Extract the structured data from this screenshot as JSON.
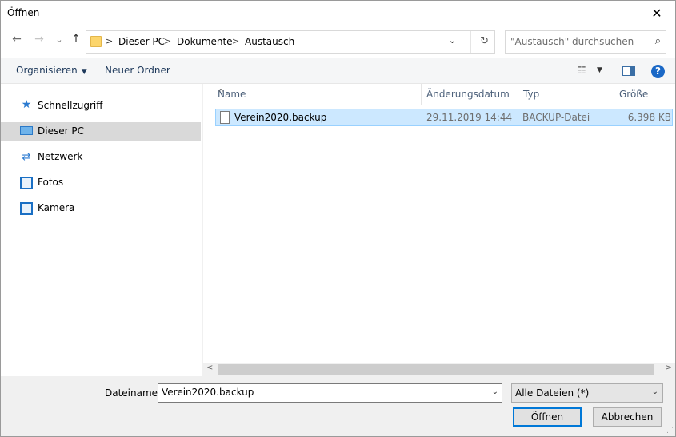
{
  "window": {
    "title": "Öffnen",
    "close": "✕"
  },
  "nav": {
    "back": "←",
    "forward": "→",
    "recent": "⌄",
    "up": "↑"
  },
  "breadcrumb": {
    "sep": ">",
    "items": [
      "Dieser PC",
      "Dokumente",
      "Austausch"
    ],
    "dropdown": "⌄",
    "refresh": "↻"
  },
  "search": {
    "placeholder": "\"Austausch\" durchsuchen",
    "icon": "⌕"
  },
  "toolbar": {
    "organize_label": "Organisieren",
    "organize_caret": "▼",
    "new_folder_label": "Neuer Ordner",
    "view_icon": "☷",
    "view_caret": "▼",
    "help_label": "?"
  },
  "sidebar": {
    "items": [
      {
        "label": "Schnellzugriff",
        "icon": "★"
      },
      {
        "label": "Dieser PC",
        "icon": ""
      },
      {
        "label": "Netzwerk",
        "icon": "⇄"
      },
      {
        "label": "Fotos",
        "icon": ""
      },
      {
        "label": "Kamera",
        "icon": ""
      }
    ],
    "selected": "Dieser PC"
  },
  "columns": {
    "name": "Name",
    "date": "Änderungsdatum",
    "type": "Typ",
    "size": "Größe",
    "sort_indicator": "^"
  },
  "files": [
    {
      "name": "Verein2020.backup",
      "date": "29.11.2019 14:44",
      "type": "BACKUP-Datei",
      "size": "6.398 KB"
    }
  ],
  "scroll": {
    "left": "<",
    "right": ">"
  },
  "footer": {
    "filename_label": "Dateiname:",
    "filename_value": "Verein2020.backup",
    "filetype_value": "Alle Dateien (*)",
    "dd": "⌄",
    "open_label": "Öffnen",
    "cancel_label": "Abbrechen"
  }
}
